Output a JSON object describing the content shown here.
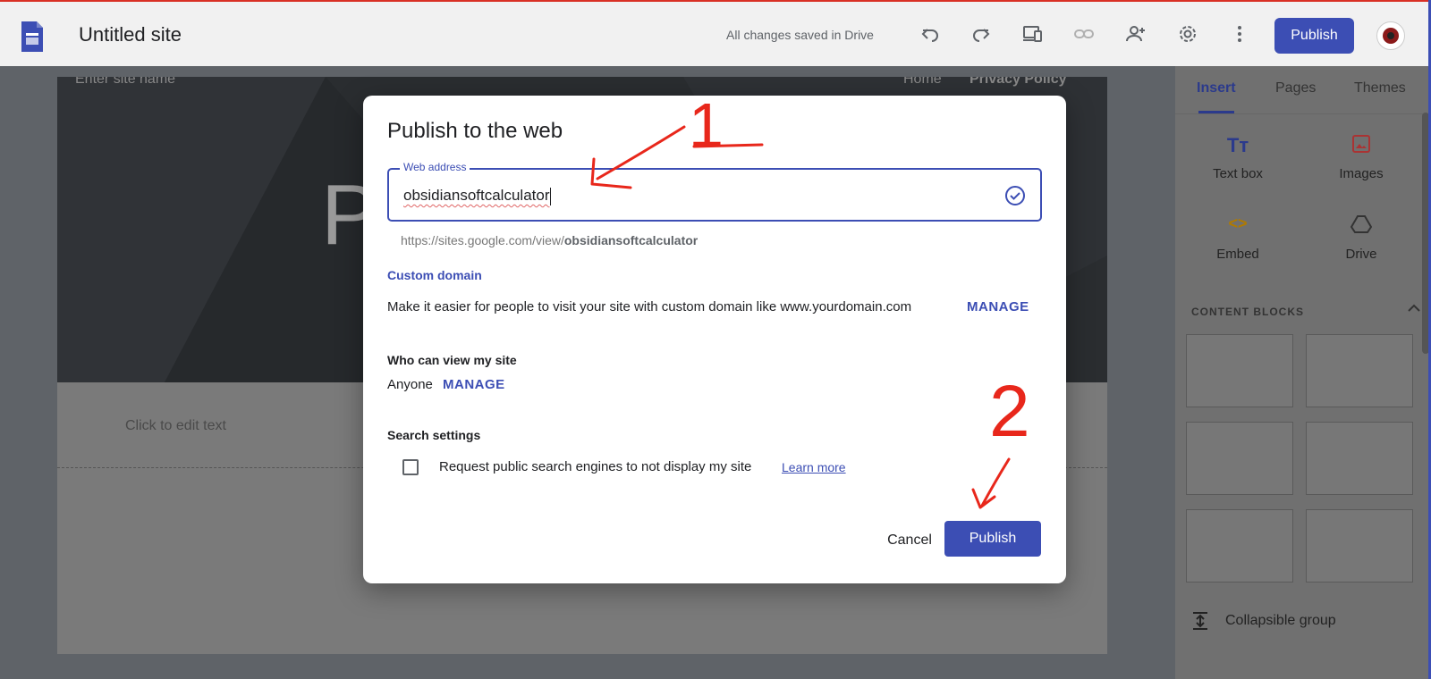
{
  "colors": {
    "accent": "#3c4eb4",
    "annotation": "#e8271b"
  },
  "topbar": {
    "title": "Untitled site",
    "save_status": "All changes saved in Drive",
    "publish_label": "Publish",
    "icons": [
      "undo-icon",
      "redo-icon",
      "preview-devices-icon",
      "link-icon",
      "share-icon",
      "settings-icon",
      "more-vert-icon"
    ]
  },
  "canvas": {
    "hero_letter": "P",
    "nav_site_name": "Enter site name",
    "nav_home": "Home",
    "nav_privacy": "Privacy Policy",
    "edit_hint": "Click to edit text"
  },
  "sidepanel": {
    "tabs": [
      "Insert",
      "Pages",
      "Themes"
    ],
    "active_tab": "Insert",
    "items": [
      {
        "label": "Text box",
        "icon": "text-box-icon",
        "glyph": "Tт"
      },
      {
        "label": "Images",
        "icon": "images-icon"
      },
      {
        "label": "Embed",
        "icon": "embed-icon",
        "glyph": "<>"
      },
      {
        "label": "Drive",
        "icon": "drive-icon"
      }
    ],
    "content_blocks_heading": "CONTENT BLOCKS",
    "collapsible_label": "Collapsible group"
  },
  "dialog": {
    "title": "Publish to the web",
    "web_address_label": "Web address",
    "web_address_value": "obsidiansoftcalculator",
    "url_prefix": "https://sites.google.com/view/",
    "url_slug": "obsidiansoftcalculator",
    "custom_domain_heading": "Custom domain",
    "custom_domain_text": "Make it easier for people to visit your site with custom domain like www.yourdomain.com",
    "manage_label": "MANAGE",
    "who_can_view_heading": "Who can view my site",
    "who_can_view_value": "Anyone",
    "who_manage_label": "MANAGE",
    "search_settings_heading": "Search settings",
    "search_checkbox_label": "Request public search engines to not display my site",
    "search_checkbox_checked": false,
    "learn_more_label": "Learn more",
    "cancel_label": "Cancel",
    "publish_label": "Publish"
  },
  "annotations": {
    "step1": "1",
    "step2": "2"
  }
}
